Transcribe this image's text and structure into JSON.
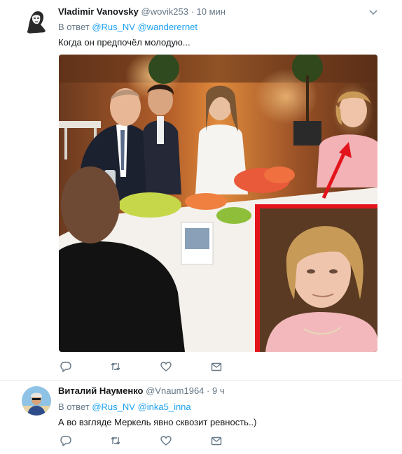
{
  "tweets": [
    {
      "name": "Vladimir Vanovsky",
      "handle": "@wovik253",
      "separator": "·",
      "time": "10 мин",
      "reply_prefix": "В ответ",
      "reply_to_1": "@Rus_NV",
      "reply_to_2": "@wanderernet",
      "text": "Когда он предпочёл молодую...",
      "has_media": true,
      "avatar_icon": "portrait-sketch-avatar"
    },
    {
      "name": "Виталий Науменко",
      "handle": "@Vnaum1964",
      "separator": "·",
      "time": "9 ч",
      "reply_prefix": "В ответ",
      "reply_to_1": "@Rus_NV",
      "reply_to_2": "@inka5_inna",
      "text": "А во взгляде Меркель явно сквозит ревность..)",
      "has_media": false,
      "avatar_icon": "photo-avatar"
    }
  ],
  "actions": [
    "reply-icon",
    "retweet-icon",
    "like-icon",
    "message-icon"
  ],
  "colors": {
    "link": "#1da1f2",
    "secondary": "#657786",
    "divider": "#e6ecf0",
    "highlight_frame": "#e3141c"
  }
}
